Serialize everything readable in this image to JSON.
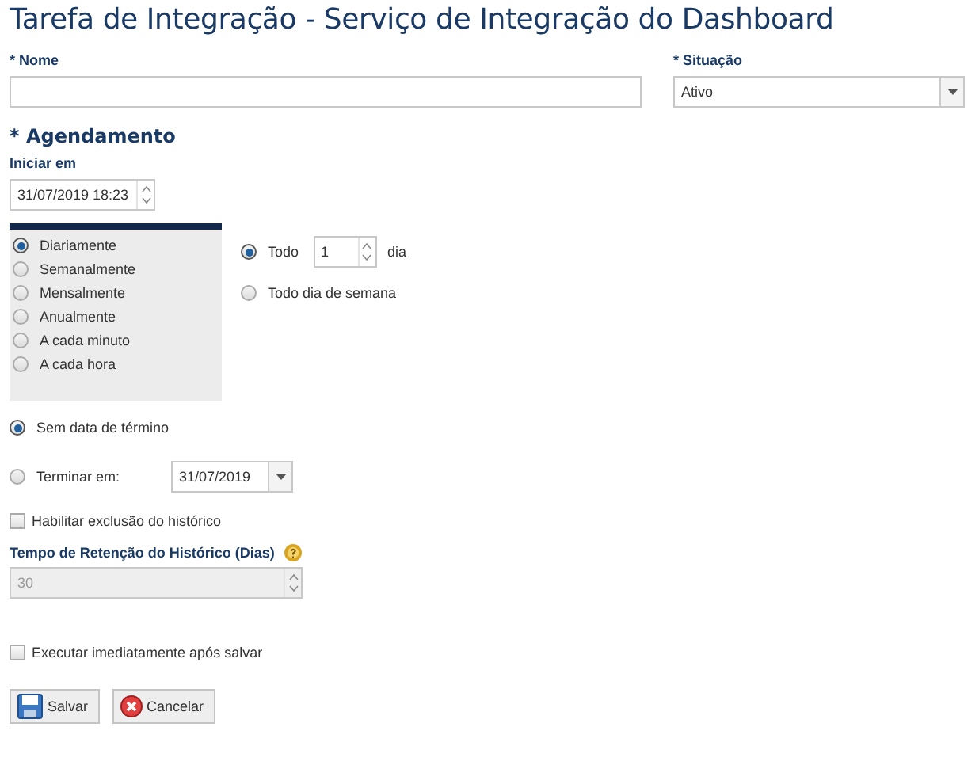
{
  "title": "Tarefa de Integração - Serviço de Integração do Dashboard",
  "name_field": {
    "label": "* Nome"
  },
  "status_field": {
    "label": "* Situação",
    "value": "Ativo"
  },
  "schedule": {
    "heading": "* Agendamento",
    "start_label": "Iniciar em",
    "start_value": "31/07/2019 18:23",
    "frequencies": [
      {
        "label": "Diariamente",
        "selected": true
      },
      {
        "label": "Semanalmente",
        "selected": false
      },
      {
        "label": "Mensalmente",
        "selected": false
      },
      {
        "label": "Anualmente",
        "selected": false
      },
      {
        "label": "A cada minuto",
        "selected": false
      },
      {
        "label": "A cada hora",
        "selected": false
      }
    ],
    "daily_options": [
      {
        "kind": "interval",
        "label": "Todo",
        "value": "1",
        "unit": "dia",
        "selected": true
      },
      {
        "kind": "plain",
        "label": "Todo dia de semana",
        "selected": false
      }
    ],
    "end_options": [
      {
        "kind": "plain",
        "label": "Sem data de término",
        "selected": true
      },
      {
        "kind": "date",
        "label": "Terminar em:",
        "value": "31/07/2019",
        "selected": false
      }
    ]
  },
  "history": {
    "checkbox": {
      "label": "Habilitar exclusão do histórico",
      "checked": false
    },
    "retention_label": "Tempo de Retenção do Histórico (Dias)",
    "retention_value": "30",
    "retention_disabled": true
  },
  "run_now": {
    "label": "Executar imediatamente após salvar",
    "checked": false
  },
  "buttons": [
    {
      "kind": "save",
      "label": "Salvar"
    },
    {
      "kind": "cancel",
      "label": "Cancelar"
    }
  ]
}
